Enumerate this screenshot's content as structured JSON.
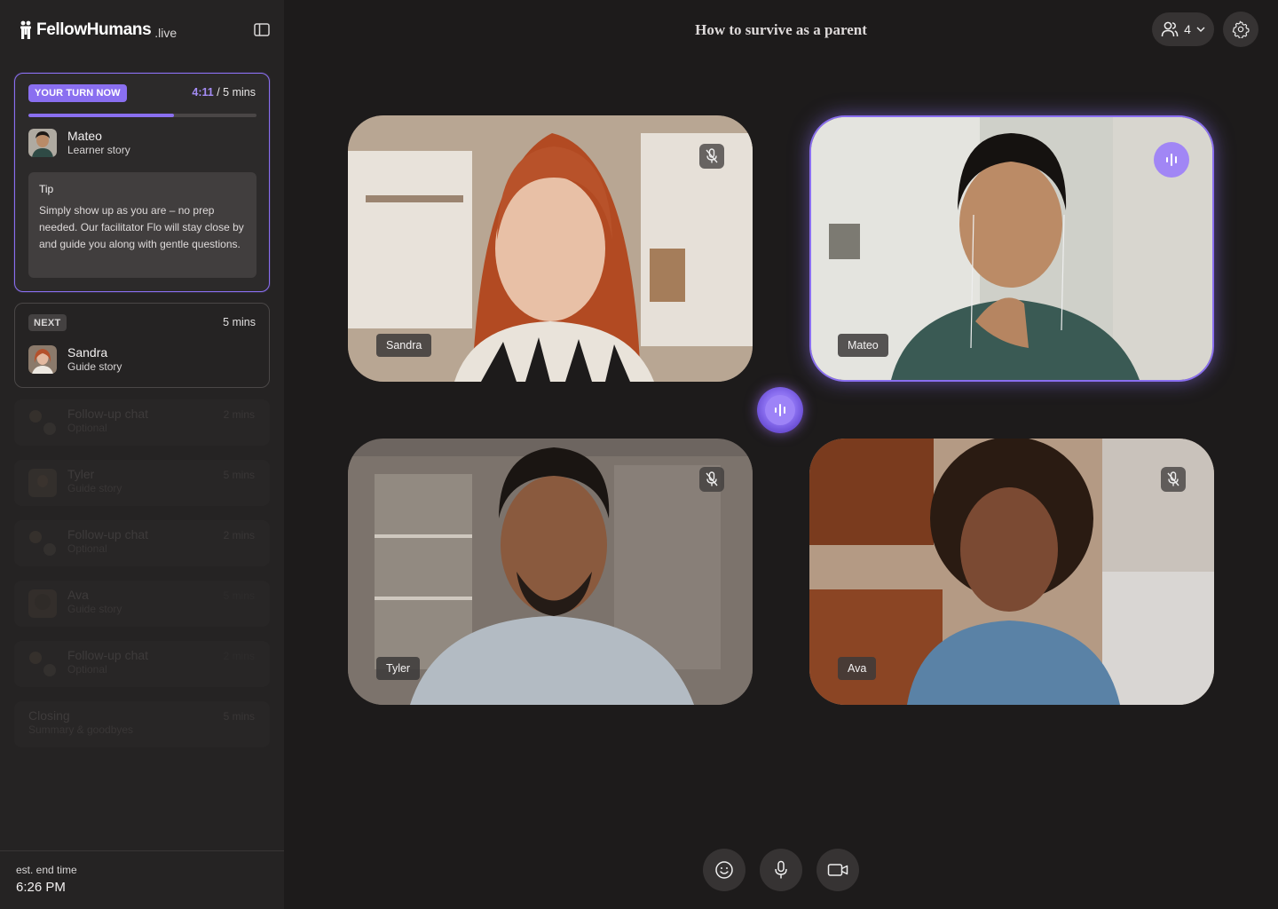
{
  "brand": {
    "name": "FellowHumans",
    "suffix": ".live"
  },
  "session": {
    "title": "How to survive as a parent"
  },
  "header": {
    "participants_count": "4"
  },
  "current_turn": {
    "badge": "YOUR TURN NOW",
    "elapsed": "4:11",
    "total": " / 5 mins",
    "progress": 0.64,
    "name": "Mateo",
    "role": "Learner story",
    "tip_title": "Tip",
    "tip_text": "Simply show up as you are – no prep needed. Our facilitator Flo will stay close by and guide you along with gentle questions."
  },
  "next_turn": {
    "badge": "NEXT",
    "duration": "5 mins",
    "name": "Sandra",
    "role": "Guide story"
  },
  "queue": [
    {
      "title": "Follow-up chat",
      "subtitle": "Optional",
      "duration": "2 mins",
      "type": "chat"
    },
    {
      "title": "Tyler",
      "subtitle": "Guide story",
      "duration": "5 mins",
      "type": "person"
    },
    {
      "title": "Follow-up chat",
      "subtitle": "Optional",
      "duration": "2 mins",
      "type": "chat"
    },
    {
      "title": "Ava",
      "subtitle": "Guide story",
      "duration": "5 mins",
      "type": "person"
    },
    {
      "title": "Follow-up chat",
      "subtitle": "Optional",
      "duration": "2 mins",
      "type": "chat"
    },
    {
      "title": "Closing",
      "subtitle": "Summary & goodbyes",
      "duration": "5 mins",
      "type": "closing"
    }
  ],
  "footer": {
    "label": "est. end time",
    "time": "6:26 PM"
  },
  "participants": [
    {
      "name": "Sandra",
      "muted": true
    },
    {
      "name": "Mateo",
      "speaking": true
    },
    {
      "name": "Tyler",
      "muted": true
    },
    {
      "name": "Ava",
      "muted": true
    }
  ],
  "controls": {
    "icons": [
      "emoji-icon",
      "microphone-icon",
      "camera-icon"
    ]
  },
  "colors": {
    "accent": "#8a6ff0",
    "background": "#1d1b1b",
    "sidebar": "#252323"
  }
}
